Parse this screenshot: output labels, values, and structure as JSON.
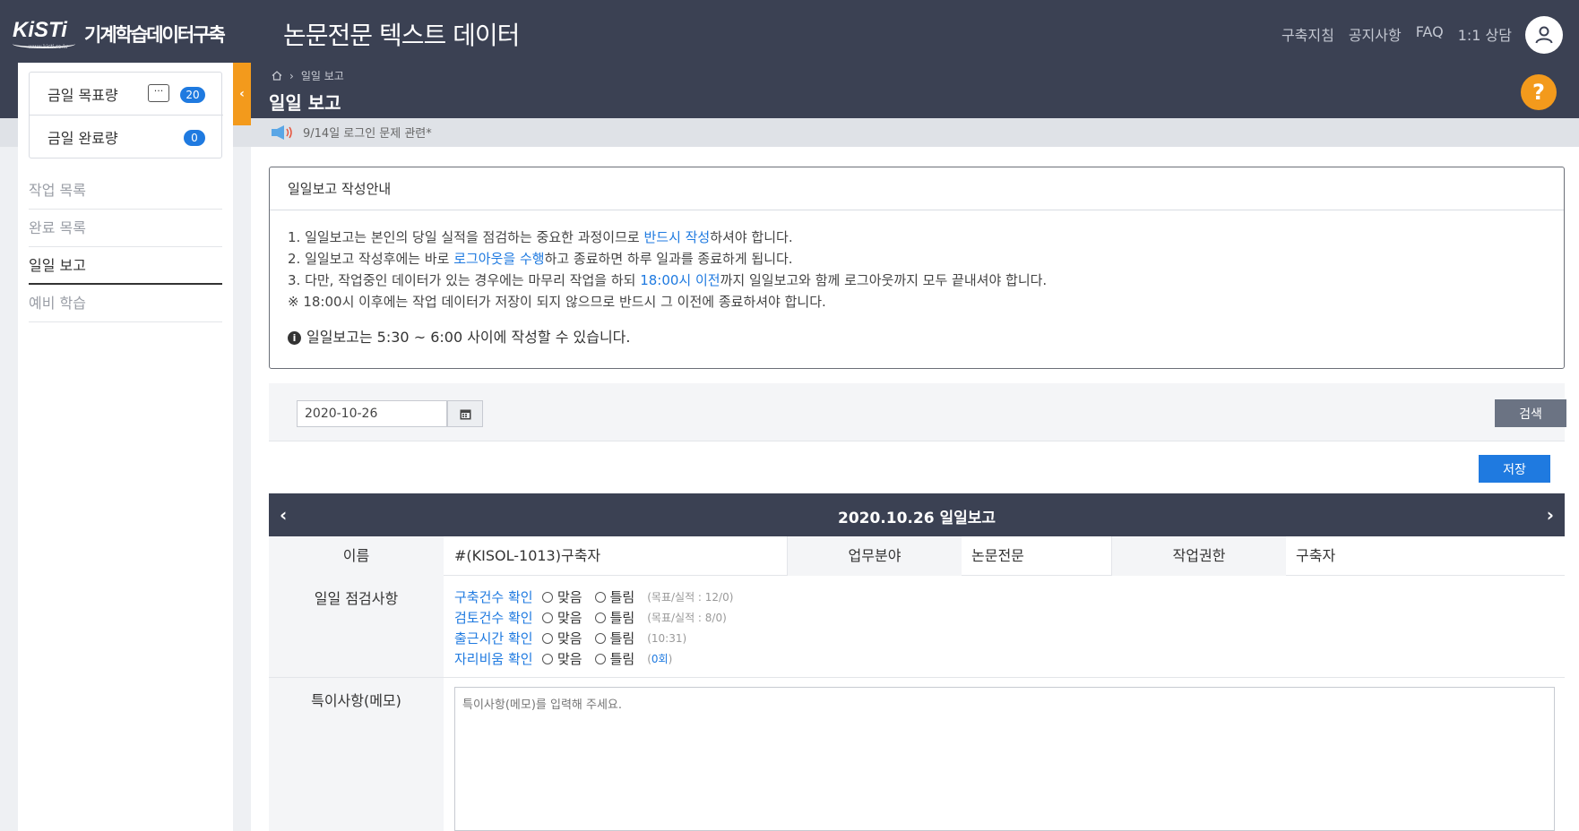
{
  "header": {
    "logo_text": "KiSTi",
    "logo_url": "www.kisti.re.kr",
    "logo_subtitle": "기계학습데이터구축",
    "app_title": "논문전문 텍스트 데이터",
    "nav": [
      "구축지침",
      "공지사항",
      "FAQ",
      "1:1 상담"
    ]
  },
  "sidebar": {
    "stats": [
      {
        "label": "금일 목표량",
        "count": "20"
      },
      {
        "label": "금일 완료량",
        "count": "0"
      }
    ],
    "chat_icon_text": "···",
    "menu": [
      {
        "label": "작업 목록",
        "active": false
      },
      {
        "label": "완료 목록",
        "active": false
      },
      {
        "label": "일일 보고",
        "active": true
      },
      {
        "label": "예비 학습",
        "active": false
      }
    ]
  },
  "breadcrumb": {
    "current": "일일 보고"
  },
  "page_title": "일일 보고",
  "notice": "9/14일 로그인 문제 관련*",
  "guide": {
    "title": "일일보고 작성안내",
    "line1_a": "1. 일일보고는 본인의 당일 실적을 점검하는 중요한 과정이므로 ",
    "line1_hl": "반드시 작성",
    "line1_b": "하셔야 합니다.",
    "line2_a": "2. 일일보고 작성후에는 바로 ",
    "line2_hl": "로그아웃을 수행",
    "line2_b": "하고 종료하면 하루 일과를 종료하게 됩니다.",
    "line3_a": "3. 다만, 작업중인 데이터가 있는 경우에는 마무리 작업을 하되 ",
    "line3_hl": "18:00시 이전",
    "line3_b": "까지 일일보고와 함께 로그아웃까지 모두 끝내셔야 합니다.",
    "line4": "※ 18:00시 이후에는 작업 데이터가 저장이 되지 않으므로 반드시 그 이전에 종료하셔야 합니다.",
    "note": "일일보고는 5:30 ~ 6:00 사이에 작성할 수 있습니다."
  },
  "search": {
    "date": "2020-10-26",
    "button": "검색"
  },
  "save_button": "저장",
  "report": {
    "title": "2020.10.26 일일보고",
    "name_label": "이름",
    "name_value": "#(KISOL-1013)구축자",
    "field_label": "업무분야",
    "field_value": "논문전문",
    "role_label": "작업권한",
    "role_value": "구축자",
    "check_label": "일일 점검사항",
    "options": {
      "yes": "맞음",
      "no": "틀림"
    },
    "checks": [
      {
        "name": "구축건수 확인",
        "meta": "(목표/실적 : 12/0)"
      },
      {
        "name": "검토건수 확인",
        "meta": "(목표/실적 : 8/0)"
      },
      {
        "name": "출근시간 확인",
        "meta": "(10:31)"
      },
      {
        "name": "자리비움 확인",
        "meta_pre": "(",
        "meta_link": "0회",
        "meta_post": ")"
      }
    ],
    "memo_label": "특이사항(메모)",
    "memo_placeholder": "특이사항(메모)를 입력해 주세요."
  },
  "colors": {
    "header": "#3b4153",
    "accent_orange": "#f39a1c",
    "primary_blue": "#1f7ae0",
    "gray_button": "#6b7383"
  }
}
